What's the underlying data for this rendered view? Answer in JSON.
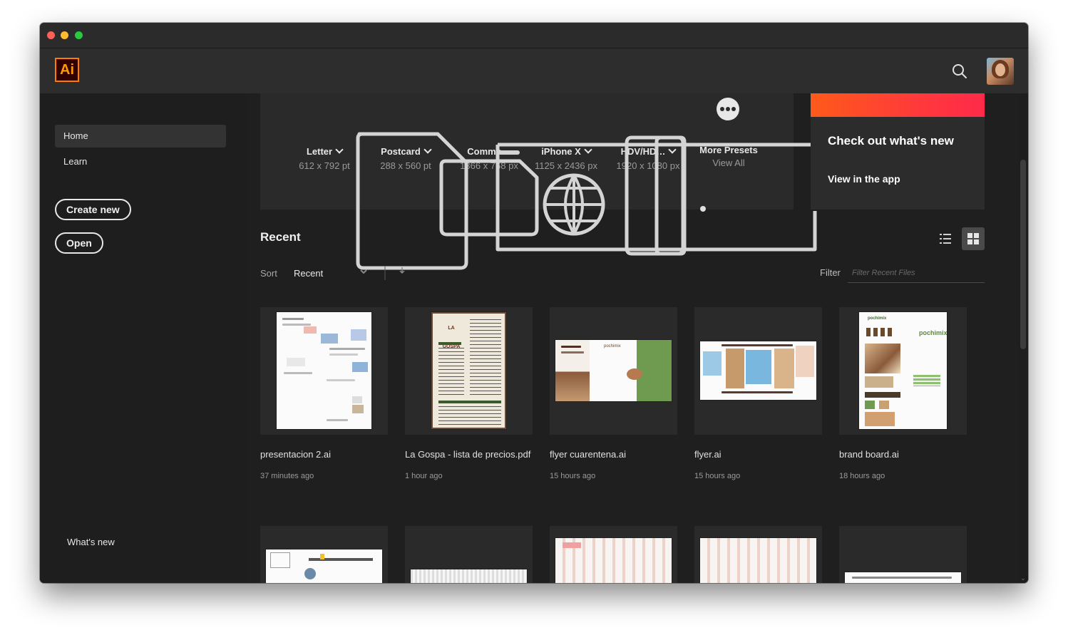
{
  "app": {
    "logo_text": "Ai",
    "brand_color": "#ff9a00"
  },
  "header": {
    "search_icon": "search-icon",
    "avatar": "user-avatar"
  },
  "sidebar": {
    "items": [
      {
        "label": "Home",
        "active": true
      },
      {
        "label": "Learn",
        "active": false
      }
    ],
    "create_new": "Create new",
    "open": "Open",
    "whats_new": "What's new"
  },
  "presets": [
    {
      "name": "Letter",
      "size": "612 x 792 pt",
      "icon": "document-icon"
    },
    {
      "name": "Postcard",
      "size": "288 x 560 pt",
      "icon": "document-icon"
    },
    {
      "name": "Commo…",
      "size": "1366 x 768 px",
      "icon": "globe-icon"
    },
    {
      "name": "iPhone X",
      "size": "1125 x 2436 px",
      "icon": "phone-icon"
    },
    {
      "name": "HDV/HD…",
      "size": "1920 x 1080 px",
      "icon": "film-icon"
    }
  ],
  "more_presets": {
    "title": "More Presets",
    "link": "View All",
    "icon": "more-dots-icon"
  },
  "promo": {
    "title": "Check out what's new",
    "link": "View in the app"
  },
  "recent": {
    "title": "Recent",
    "sort_label": "Sort",
    "sort_value": "Recent",
    "filter_label": "Filter",
    "filter_placeholder": "Filter Recent Files",
    "view_modes": [
      "list-view-icon",
      "grid-view-icon"
    ],
    "active_view": "grid",
    "files": [
      {
        "name": "presentacion 2.ai",
        "time": "37 minutes ago"
      },
      {
        "name": "La Gospa - lista de precios.pdf",
        "time": "1 hour ago"
      },
      {
        "name": "flyer cuarentena.ai",
        "time": "15 hours ago"
      },
      {
        "name": "flyer.ai",
        "time": "15 hours ago"
      },
      {
        "name": "brand board.ai",
        "time": "18 hours ago"
      }
    ]
  },
  "thumbnail_text": {
    "menu_logo": "LA GOSPA",
    "brand": "pochimix"
  }
}
